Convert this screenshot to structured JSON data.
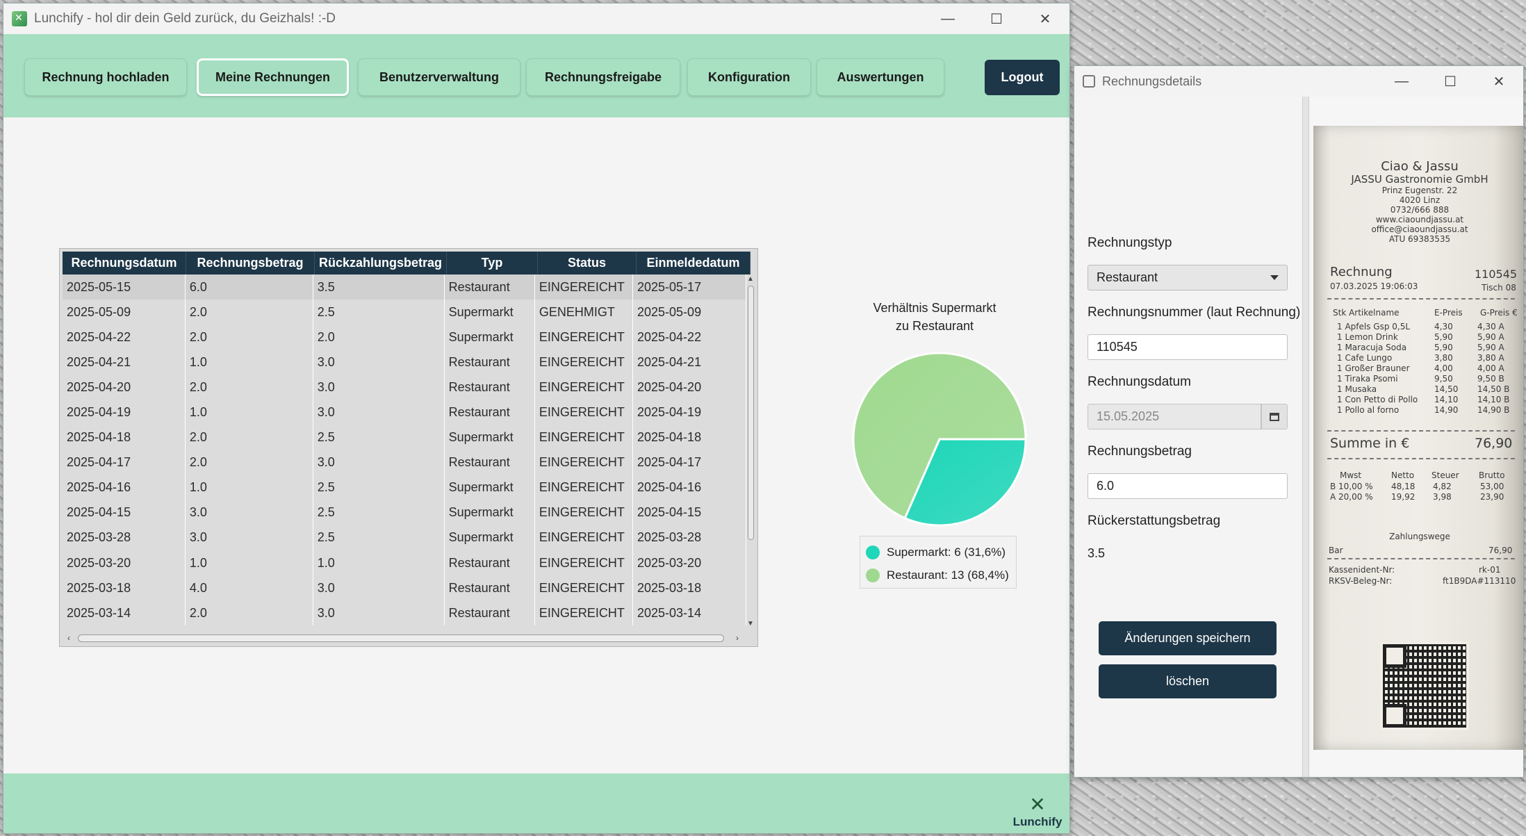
{
  "main_window": {
    "title": "Lunchify - hol dir dein Geld zurück, du Geizhals! :-D",
    "controls": {
      "minimize": "—",
      "maximize": "☐",
      "close": "✕"
    }
  },
  "nav": {
    "items": [
      {
        "label": "Rechnung hochladen",
        "active": false
      },
      {
        "label": "Meine Rechnungen",
        "active": true
      },
      {
        "label": "Benutzerverwaltung",
        "active": false
      },
      {
        "label": "Rechnungsfreigabe",
        "active": false
      },
      {
        "label": "Konfiguration",
        "active": false
      },
      {
        "label": "Auswertungen",
        "active": false
      }
    ],
    "logout_label": "Logout"
  },
  "table": {
    "columns": [
      "Rechnungsdatum",
      "Rechnungsbetrag",
      "Rückzahlungsbetrag",
      "Typ",
      "Status",
      "Einmeldedatum"
    ],
    "rows": [
      [
        "2025-05-15",
        "6.0",
        "3.5",
        "Restaurant",
        "EINGEREICHT",
        "2025-05-17"
      ],
      [
        "2025-05-09",
        "2.0",
        "2.5",
        "Supermarkt",
        "GENEHMIGT",
        "2025-05-09"
      ],
      [
        "2025-04-22",
        "2.0",
        "2.0",
        "Supermarkt",
        "EINGEREICHT",
        "2025-04-22"
      ],
      [
        "2025-04-21",
        "1.0",
        "3.0",
        "Restaurant",
        "EINGEREICHT",
        "2025-04-21"
      ],
      [
        "2025-04-20",
        "2.0",
        "3.0",
        "Restaurant",
        "EINGEREICHT",
        "2025-04-20"
      ],
      [
        "2025-04-19",
        "1.0",
        "3.0",
        "Restaurant",
        "EINGEREICHT",
        "2025-04-19"
      ],
      [
        "2025-04-18",
        "2.0",
        "2.5",
        "Supermarkt",
        "EINGEREICHT",
        "2025-04-18"
      ],
      [
        "2025-04-17",
        "2.0",
        "3.0",
        "Restaurant",
        "EINGEREICHT",
        "2025-04-17"
      ],
      [
        "2025-04-16",
        "1.0",
        "2.5",
        "Supermarkt",
        "EINGEREICHT",
        "2025-04-16"
      ],
      [
        "2025-04-15",
        "3.0",
        "2.5",
        "Supermarkt",
        "EINGEREICHT",
        "2025-04-15"
      ],
      [
        "2025-03-28",
        "3.0",
        "2.5",
        "Supermarkt",
        "EINGEREICHT",
        "2025-03-28"
      ],
      [
        "2025-03-20",
        "1.0",
        "1.0",
        "Restaurant",
        "EINGEREICHT",
        "2025-03-20"
      ],
      [
        "2025-03-18",
        "4.0",
        "3.0",
        "Restaurant",
        "EINGEREICHT",
        "2025-03-18"
      ],
      [
        "2025-03-14",
        "2.0",
        "3.0",
        "Restaurant",
        "EINGEREICHT",
        "2025-03-14"
      ]
    ],
    "selected_row": 0
  },
  "chart_data": {
    "type": "pie",
    "title_lines": [
      "Verhältnis Supermarkt",
      "zu Restaurant"
    ],
    "slices": [
      {
        "name": "Supermarkt",
        "value": 6,
        "label": "Supermarkt: 6 (31,6%)",
        "color": "#1ed6b8"
      },
      {
        "name": "Restaurant",
        "value": 13,
        "label": "Restaurant: 13 (68,4%)",
        "color": "#9fd98f"
      }
    ],
    "legend": "bottom"
  },
  "footer": {
    "brand": "Lunchify"
  },
  "details_window": {
    "title": "Rechnungsdetails",
    "controls": {
      "minimize": "—",
      "maximize": "☐",
      "close": "✕"
    },
    "type_label": "Rechnungstyp",
    "type_value": "Restaurant",
    "number_label": "Rechnungsnummer (laut Rechnung)",
    "number_value": "110545",
    "date_label": "Rechnungsdatum",
    "date_value": "15.05.2025",
    "amount_label": "Rechnungsbetrag",
    "amount_value": "6.0",
    "refund_label": "Rückerstattungsbetrag",
    "refund_value": "3.5",
    "save_label": "Änderungen speichern",
    "delete_label": "löschen"
  },
  "receipt": {
    "header": [
      "Ciao & Jassu",
      "JASSU Gastronomie GmbH",
      "Prinz Eugenstr. 22",
      "4020 Linz",
      "0732/666 888",
      "www.ciaoundjassu.at",
      "office@ciaoundjassu.at",
      "ATU 69383535"
    ],
    "rechnung_label": "Rechnung",
    "rechnung_no": "110545",
    "datetime": "07.03.2025 19:06:03",
    "table_no": "Tisch 08",
    "col_headers": [
      "Stk Artikelname",
      "E-Preis",
      "G-Preis €"
    ],
    "items": [
      [
        "1 Apfels Gsp 0,5L",
        "4,30",
        "4,30 A"
      ],
      [
        "1 Lemon Drink",
        "5,90",
        "5,90 A"
      ],
      [
        "1 Maracuja Soda",
        "5,90",
        "5,90 A"
      ],
      [
        "1 Cafe Lungo",
        "3,80",
        "3,80 A"
      ],
      [
        "1 Großer Brauner",
        "4,00",
        "4,00 A"
      ],
      [
        "1 Tiraka Psomi",
        "9,50",
        "9,50 B"
      ],
      [
        "1 Musaka",
        "14,50",
        "14,50 B"
      ],
      [
        "1 Con Petto di Pollo",
        "14,10",
        "14,10 B"
      ],
      [
        "1 Pollo al forno",
        "14,90",
        "14,90 B"
      ]
    ],
    "total_label": "Summe in €",
    "total_value": "76,90",
    "tax_headers": [
      "Mwst",
      "Netto",
      "Steuer",
      "Brutto"
    ],
    "tax_rows": [
      [
        "B 10,00 %",
        "48,18",
        "4,82",
        "53,00"
      ],
      [
        "A 20,00 %",
        "19,92",
        "3,98",
        "23,90"
      ]
    ],
    "zahlungswege": "Zahlungswege",
    "bar_label": "Bar",
    "bar_value": "76,90",
    "kassen_label": "Kassenident-Nr:",
    "kassen_value": "rk-01",
    "rksv_label": "RKSV-Beleg-Nr:",
    "rksv_value": "ft1B9DA#113110"
  }
}
